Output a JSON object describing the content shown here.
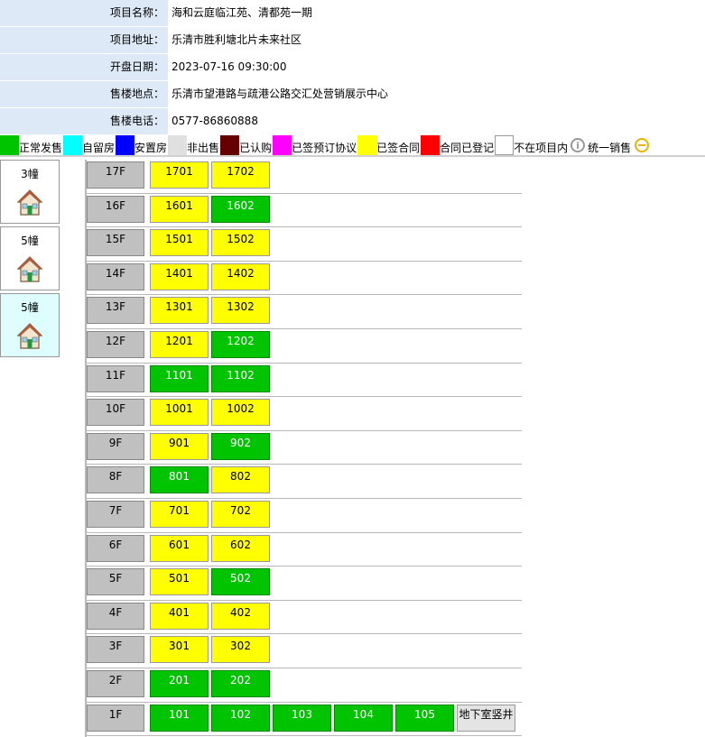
{
  "info": [
    {
      "label": "项目名称：",
      "value": "海和云庭临江苑、清都苑一期"
    },
    {
      "label": "项目地址：",
      "value": "乐清市胜利塘北片未来社区"
    },
    {
      "label": "开盘日期：",
      "value": "2023-07-16 09:30:00"
    },
    {
      "label": "售楼地点：",
      "value": "乐清市望港路与疏港公路交汇处营销展示中心"
    },
    {
      "label": "售楼电话：",
      "value": "0577-86860888"
    }
  ],
  "legend": [
    {
      "label": "正常发售",
      "color": "#00c400"
    },
    {
      "label": "自留房",
      "color": "#00ffff"
    },
    {
      "label": "安置房",
      "color": "#0000ff"
    },
    {
      "label": "非出售",
      "color": "#e0e0e0"
    },
    {
      "label": "已认购",
      "color": "#660000"
    },
    {
      "label": "已签预订协议",
      "color": "#ff00ff"
    },
    {
      "label": "已签合同",
      "color": "#ffff00"
    },
    {
      "label": "合同已登记",
      "color": "#ff0000"
    },
    {
      "label": "不在项目内",
      "color": "#ffffff"
    },
    {
      "label": "统一销售",
      "icon": "info-circle-icon"
    }
  ],
  "buildings": [
    {
      "name": "3幢",
      "icon": "house-icon"
    },
    {
      "name": "5幢",
      "icon": "house-icon"
    },
    {
      "name": "5幢",
      "icon": "house-icon"
    }
  ],
  "floors": [
    {
      "floor": "17F",
      "units": [
        {
          "no": "1701",
          "status": "yellow"
        },
        {
          "no": "1702",
          "status": "yellow"
        }
      ]
    },
    {
      "floor": "16F",
      "units": [
        {
          "no": "1601",
          "status": "yellow"
        },
        {
          "no": "1602",
          "status": "green"
        }
      ]
    },
    {
      "floor": "15F",
      "units": [
        {
          "no": "1501",
          "status": "yellow"
        },
        {
          "no": "1502",
          "status": "yellow"
        }
      ]
    },
    {
      "floor": "14F",
      "units": [
        {
          "no": "1401",
          "status": "yellow"
        },
        {
          "no": "1402",
          "status": "yellow"
        }
      ]
    },
    {
      "floor": "13F",
      "units": [
        {
          "no": "1301",
          "status": "yellow"
        },
        {
          "no": "1302",
          "status": "yellow"
        }
      ]
    },
    {
      "floor": "12F",
      "units": [
        {
          "no": "1201",
          "status": "yellow"
        },
        {
          "no": "1202",
          "status": "green"
        }
      ]
    },
    {
      "floor": "11F",
      "units": [
        {
          "no": "1101",
          "status": "green"
        },
        {
          "no": "1102",
          "status": "green"
        }
      ]
    },
    {
      "floor": "10F",
      "units": [
        {
          "no": "1001",
          "status": "yellow"
        },
        {
          "no": "1002",
          "status": "yellow"
        }
      ]
    },
    {
      "floor": "9F",
      "units": [
        {
          "no": "901",
          "status": "yellow"
        },
        {
          "no": "902",
          "status": "green"
        }
      ]
    },
    {
      "floor": "8F",
      "units": [
        {
          "no": "801",
          "status": "green"
        },
        {
          "no": "802",
          "status": "yellow"
        }
      ]
    },
    {
      "floor": "7F",
      "units": [
        {
          "no": "701",
          "status": "yellow"
        },
        {
          "no": "702",
          "status": "yellow"
        }
      ]
    },
    {
      "floor": "6F",
      "units": [
        {
          "no": "601",
          "status": "yellow"
        },
        {
          "no": "602",
          "status": "yellow"
        }
      ]
    },
    {
      "floor": "5F",
      "units": [
        {
          "no": "501",
          "status": "yellow"
        },
        {
          "no": "502",
          "status": "green"
        }
      ]
    },
    {
      "floor": "4F",
      "units": [
        {
          "no": "401",
          "status": "yellow"
        },
        {
          "no": "402",
          "status": "yellow"
        }
      ]
    },
    {
      "floor": "3F",
      "units": [
        {
          "no": "301",
          "status": "yellow"
        },
        {
          "no": "302",
          "status": "yellow"
        }
      ]
    },
    {
      "floor": "2F",
      "units": [
        {
          "no": "201",
          "status": "green"
        },
        {
          "no": "202",
          "status": "green"
        }
      ]
    },
    {
      "floor": "1F",
      "units": [
        {
          "no": "101",
          "status": "green"
        },
        {
          "no": "102",
          "status": "green"
        },
        {
          "no": "103",
          "status": "green"
        },
        {
          "no": "104",
          "status": "green"
        },
        {
          "no": "105",
          "status": "green"
        },
        {
          "no": "地下室竖井",
          "status": "grey"
        }
      ]
    }
  ]
}
